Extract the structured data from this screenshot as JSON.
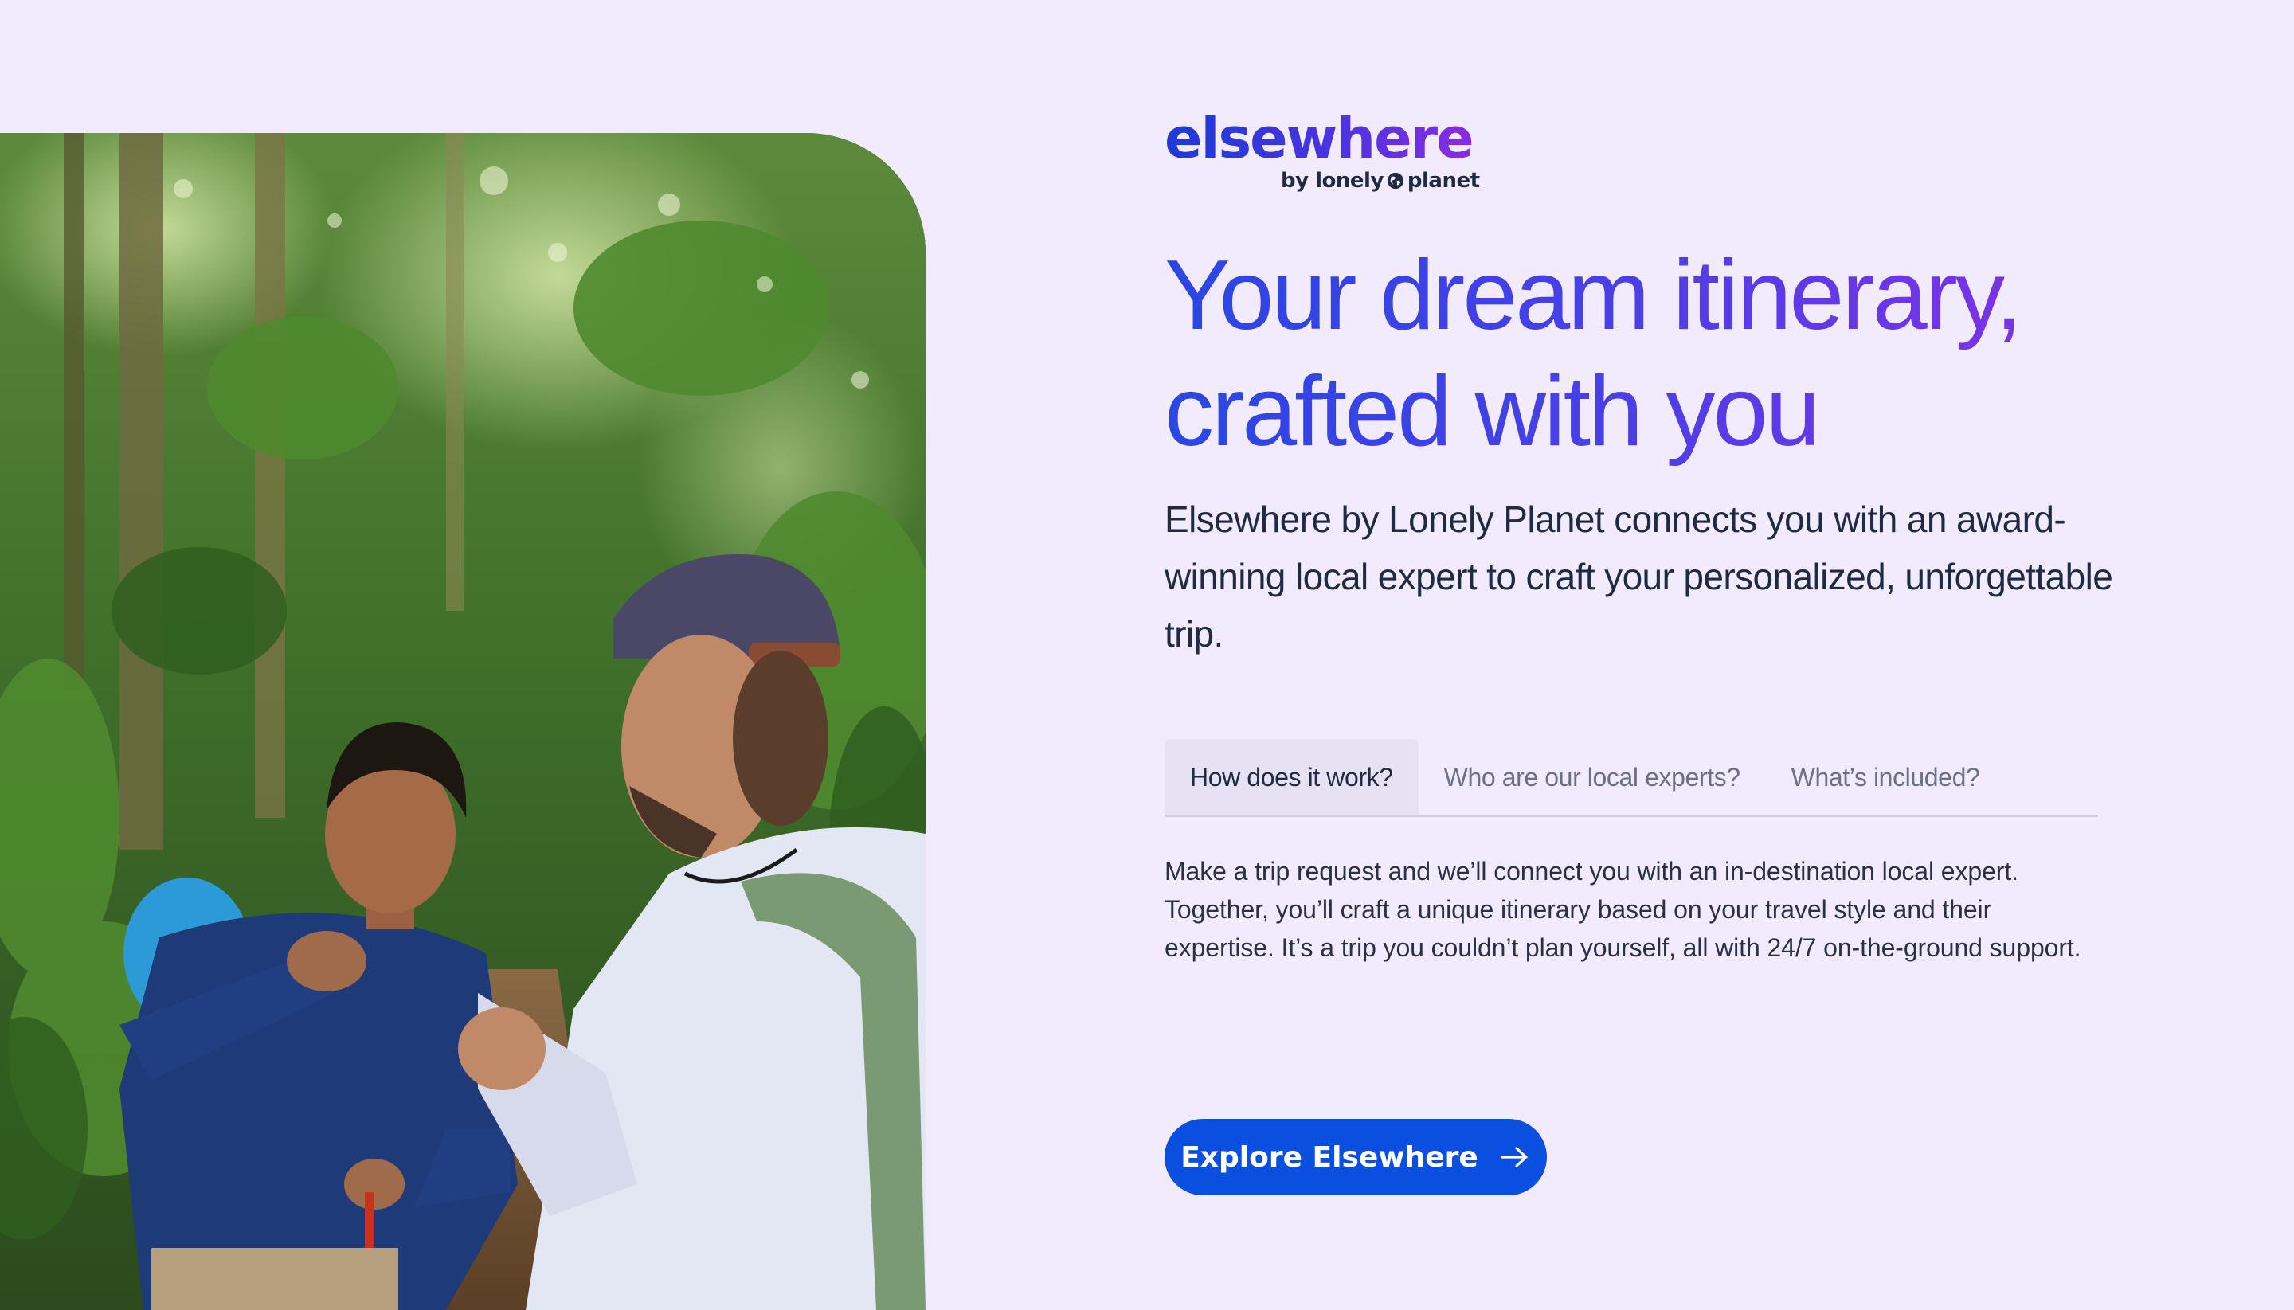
{
  "brand": {
    "logo_word": "elsewhere",
    "byline_prefix": "by lonely",
    "byline_suffix": "planet",
    "logo_gradient": [
      "#1d3ad6",
      "#8a2be2"
    ]
  },
  "hero": {
    "headline_line1": "Your dream itinerary,",
    "headline_line2": "crafted with you",
    "intro": "Elsewhere by Lonely Planet connects you with an award-winning local expert to craft your personalized, unforgettable trip.",
    "photo_icon": "hiking-guide-photo"
  },
  "tabs": [
    {
      "label": "How does it work?",
      "active": true
    },
    {
      "label": "Who are our local experts?",
      "active": false
    },
    {
      "label": "What’s included?",
      "active": false
    }
  ],
  "tab_content": {
    "body": "Make a trip request and we’ll connect you with an in-destination local expert. Together, you’ll craft a unique itinerary based on your travel style and their expertise. It’s a trip you couldn’t plan yourself, all with 24/7 on-the-ground support."
  },
  "cta": {
    "label": "Explore Elsewhere",
    "icon": "arrow-right-icon"
  },
  "colors": {
    "background": "#f1ebfd",
    "primary_button": "#0b4fe0",
    "text": "#1f2a44",
    "headline_gradient_start": "#2a47e4",
    "headline_gradient_end": "#8b2fe6"
  }
}
